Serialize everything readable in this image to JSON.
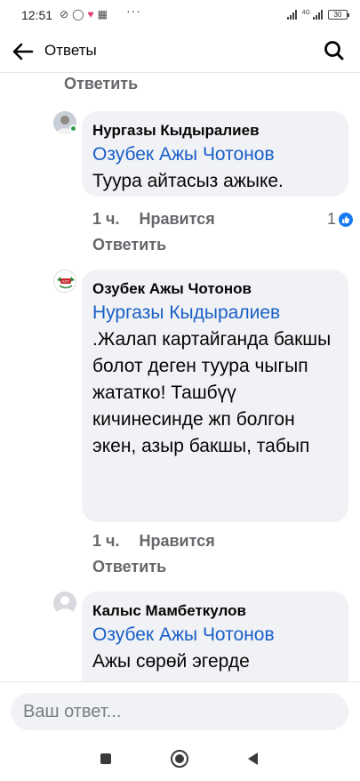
{
  "status_bar": {
    "time": "12:51",
    "network": "4G",
    "battery": "30"
  },
  "header": {
    "title": "Ответы",
    "back_icon": "arrow-left-icon",
    "search_icon": "search-icon"
  },
  "thread": {
    "top_reply_label": "Ответить",
    "comments": [
      {
        "author": "Нургазы Кыдыралиев",
        "mention": "Озубек Ажы Чотонов",
        "text": "Туура айтасыз ажыке.",
        "time": "1 ч.",
        "like_label": "Нравится",
        "reply_label": "Ответить",
        "reaction_count": "1",
        "reaction_color": "#1877f2"
      },
      {
        "author": "Озубек Ажы Чотонов",
        "mention": "Нургазы Кыдыралиев",
        "text": " .Жалап картайганда бакшы болот деген туура чыгып жататко! Ташбүү кичинесинде жп болгон экен, азыр бакшы, табып",
        "time": "1 ч.",
        "like_label": "Нравится",
        "reply_label": "Ответить"
      },
      {
        "author": "Калыс Мамбеткулов",
        "mention": "Озубек Ажы Чотонов",
        "text": "Ажы сөрөй эгерде"
      }
    ]
  },
  "composer": {
    "placeholder": "Ваш ответ..."
  },
  "colors": {
    "mention": "#1a5fc7",
    "bubble": "#f0f2f5",
    "secondary_text": "#65676b"
  }
}
